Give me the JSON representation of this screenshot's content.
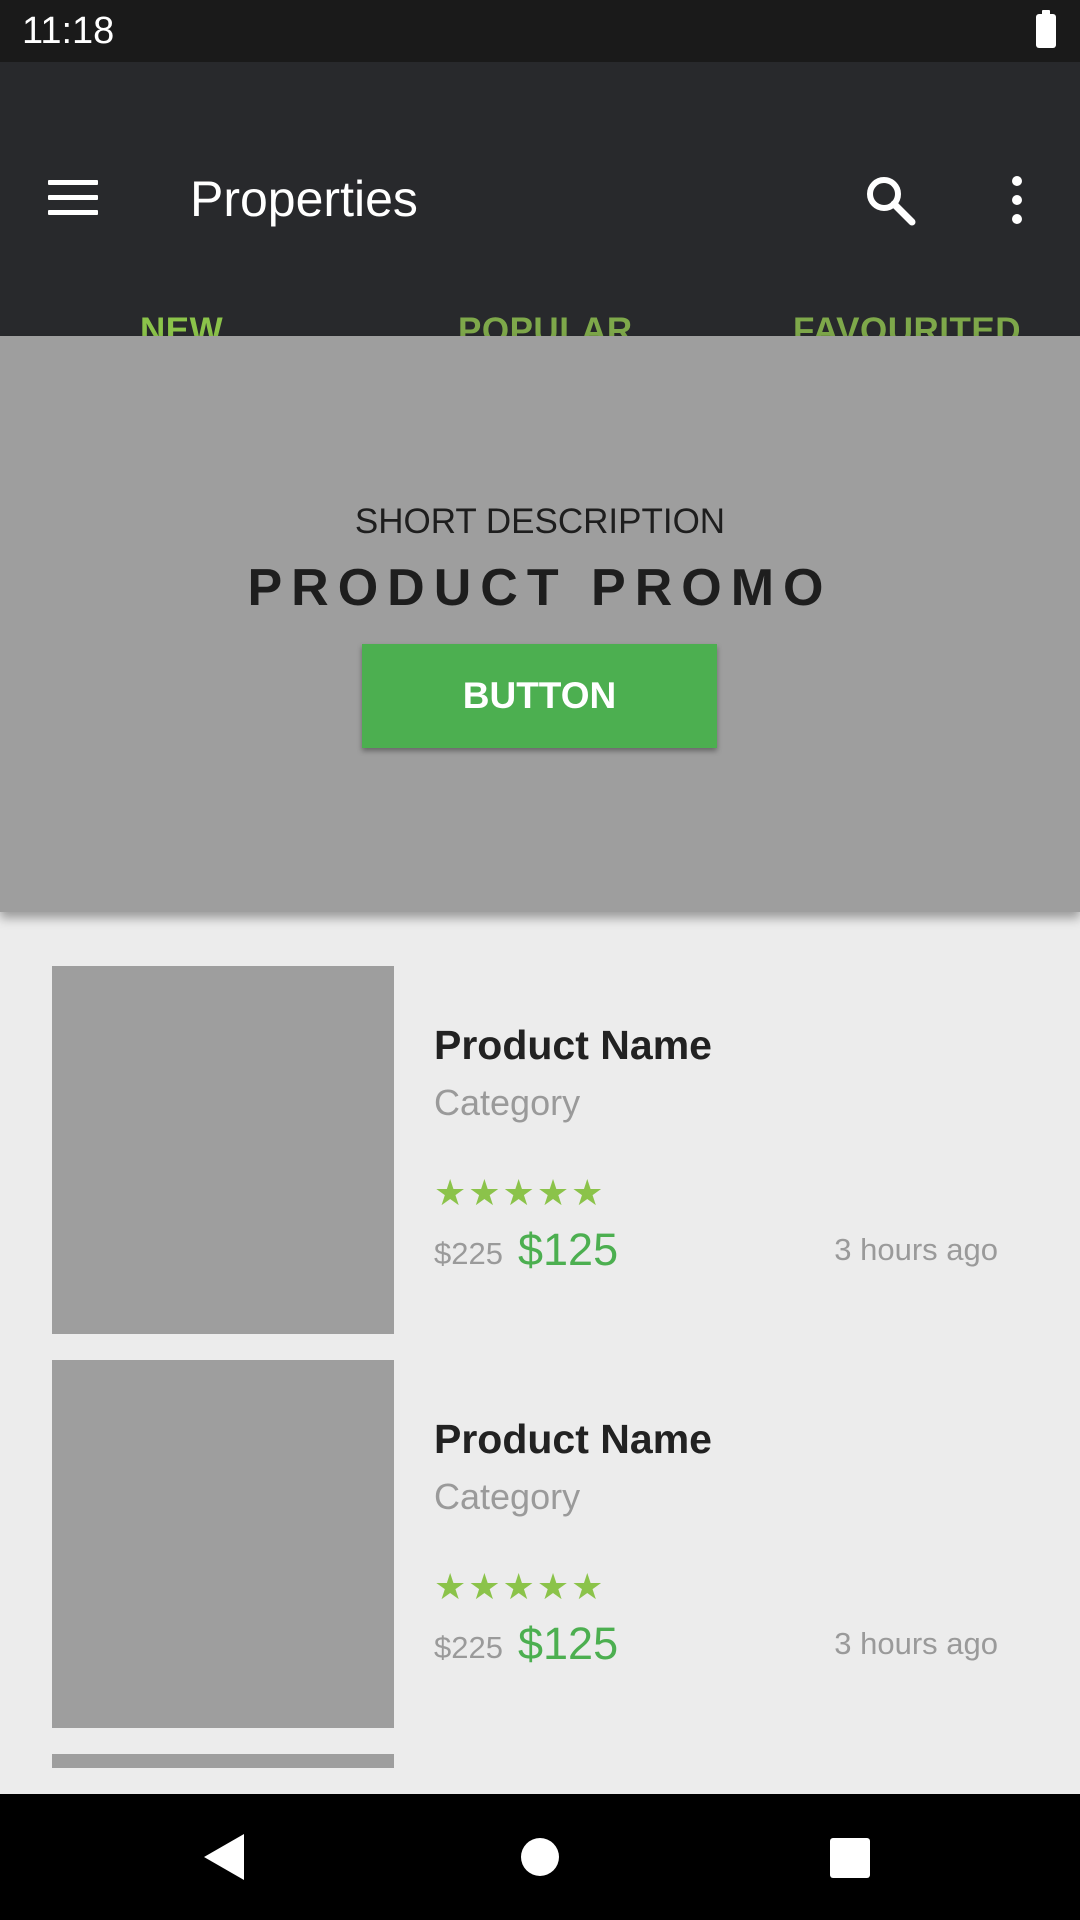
{
  "status_bar": {
    "time": "11:18"
  },
  "app_bar": {
    "title": "Properties"
  },
  "tabs": [
    {
      "label": "NEW",
      "selected": true
    },
    {
      "label": "POPULAR",
      "selected": false
    },
    {
      "label": "FAVOURITED",
      "selected": false
    }
  ],
  "colors": {
    "accent": "#8bc34a",
    "tab_inactive": "#7ea84a",
    "app_bar": "#28292c",
    "button": "#4caf50",
    "price": "#4caf50"
  },
  "promo": {
    "short_description": "SHORT DESCRIPTION",
    "title": "PRODUCT PROMO",
    "button_label": "BUTTON"
  },
  "products": [
    {
      "name": "Product Name",
      "category": "Category",
      "stars": "★★★★★",
      "rating": 5,
      "old_price": "$225",
      "price": "$125",
      "time": "3 hours ago"
    },
    {
      "name": "Product Name",
      "category": "Category",
      "stars": "★★★★★",
      "rating": 5,
      "old_price": "$225",
      "price": "$125",
      "time": "3 hours ago"
    }
  ],
  "icons": {
    "menu": "hamburger-menu-icon",
    "search": "search-icon",
    "more": "more-vert-icon",
    "back": "back-icon",
    "home": "home-icon",
    "recent": "recent-apps-icon"
  }
}
